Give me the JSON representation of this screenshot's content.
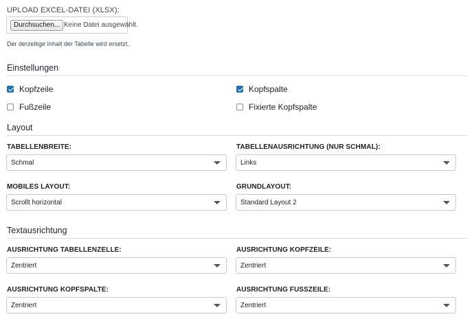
{
  "upload": {
    "label": "UPLOAD EXCEL-DATEI (XLSX):",
    "button_label": "Durchsuchen...",
    "status": "Keine Datei ausgewählt.",
    "note": "Der derzeitige Inhalt der Tabelle wird ersetzt."
  },
  "settings": {
    "title": "Einstellungen",
    "checkboxes": [
      {
        "label": "Kopfzeile",
        "checked": true
      },
      {
        "label": "Kopfspalte",
        "checked": true
      },
      {
        "label": "Fußzeile",
        "checked": false
      },
      {
        "label": "Fixierte Kopfspalte",
        "checked": false
      }
    ]
  },
  "layout": {
    "title": "Layout",
    "fields": [
      {
        "label": "TABELLENBREITE:",
        "value": "Schmal"
      },
      {
        "label": "TABELLENAUSRICHTUNG (NUR SCHMAL):",
        "value": "Links"
      },
      {
        "label": "MOBILES LAYOUT:",
        "value": "Scrollt horizontal"
      },
      {
        "label": "GRUNDLAYOUT:",
        "value": "Standard Layout 2"
      }
    ]
  },
  "text_alignment": {
    "title": "Textausrichtung",
    "fields": [
      {
        "label": "AUSRICHTUNG TABELLENZELLE:",
        "value": "Zentriert"
      },
      {
        "label": "AUSRICHTUNG KOPFZEILE:",
        "value": "Zentriert"
      },
      {
        "label": "AUSRICHTUNG KOPFSPALTE:",
        "value": "Zentriert"
      },
      {
        "label": "AUSRICHTUNG FUSSZEILE:",
        "value": "Zentriert"
      }
    ]
  },
  "colors": {
    "checkbox_checked": "#2271b1",
    "divider": "#dcdcde"
  }
}
